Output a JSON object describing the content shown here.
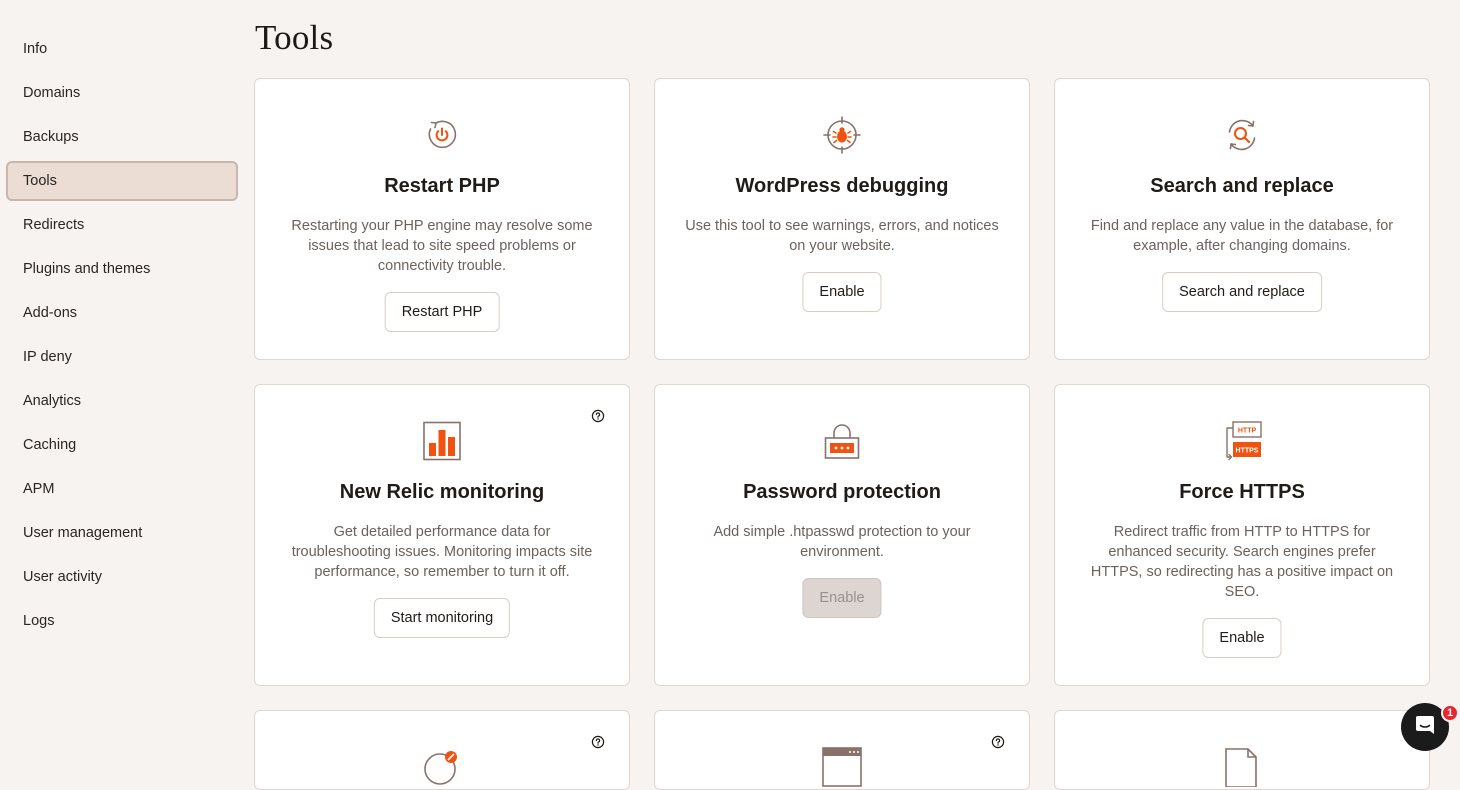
{
  "sidebar": {
    "items": [
      {
        "label": "Info"
      },
      {
        "label": "Domains"
      },
      {
        "label": "Backups"
      },
      {
        "label": "Tools",
        "active": true
      },
      {
        "label": "Redirects"
      },
      {
        "label": "Plugins and themes"
      },
      {
        "label": "Add-ons"
      },
      {
        "label": "IP deny"
      },
      {
        "label": "Analytics"
      },
      {
        "label": "Caching"
      },
      {
        "label": "APM"
      },
      {
        "label": "User management"
      },
      {
        "label": "User activity"
      },
      {
        "label": "Logs"
      }
    ]
  },
  "page": {
    "title": "Tools"
  },
  "cards": [
    {
      "icon": "restart-power-icon",
      "title": "Restart PHP",
      "description": "Restarting your PHP engine may resolve some issues that lead to site speed problems or connectivity trouble.",
      "button": "Restart PHP"
    },
    {
      "icon": "bug-target-icon",
      "title": "WordPress debugging",
      "description": "Use this tool to see warnings, errors, and notices on your website.",
      "button": "Enable"
    },
    {
      "icon": "search-refresh-icon",
      "title": "Search and replace",
      "description": "Find and replace any value in the database, for example, after changing domains.",
      "button": "Search and replace"
    },
    {
      "icon": "bar-chart-icon",
      "title": "New Relic monitoring",
      "description": "Get detailed performance data for troubleshooting issues. Monitoring impacts site performance, so remember to turn it off.",
      "button": "Start monitoring",
      "help": true
    },
    {
      "icon": "padlock-icon",
      "title": "Password protection",
      "description": "Add simple .htpasswd protection to your environment.",
      "button": "Enable",
      "disabled": true
    },
    {
      "icon": "http-https-icon",
      "icon_text_top": "HTTP",
      "icon_text_bottom": "HTTPS",
      "title": "Force HTTPS",
      "description": "Redirect traffic from HTTP to HTTPS for enhanced security. Search engines prefer HTTPS, so redirecting has a positive impact on SEO.",
      "button": "Enable"
    }
  ],
  "chat": {
    "badge_count": "1"
  },
  "colors": {
    "accent": "#f0520f",
    "icon_stroke": "#8a716a",
    "active_nav_bg": "#ebddd4"
  }
}
